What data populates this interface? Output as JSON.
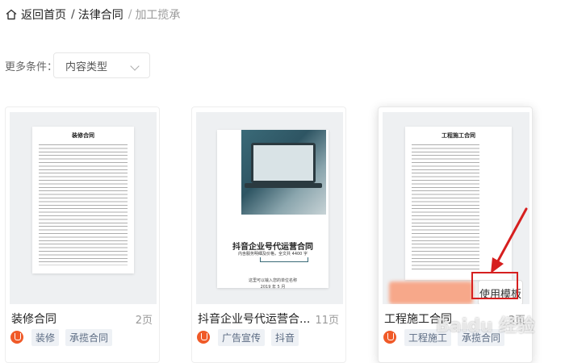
{
  "breadcrumb": {
    "home": "返回首页",
    "separator": "/",
    "category": "法律合同",
    "current": "加工揽承"
  },
  "filter": {
    "label": "更多条件：",
    "select_value": "内容类型"
  },
  "cards": [
    {
      "title": "装修合同",
      "pages": "2页",
      "tags": [
        "装修",
        "承揽合同"
      ],
      "doc_title": "装修合同"
    },
    {
      "title": "抖音企业号代运营合...",
      "pages": "11页",
      "tags": [
        "广告宣传",
        "抖音"
      ],
      "poster_title": "抖音企业号代运营合同",
      "poster_subtitle": "内含服务明细及价格，全文共 4400 字",
      "poster_placeholder": "这里可以输入您的单位名称",
      "poster_date": "2019 年 5 月"
    },
    {
      "title": "工程施工合同",
      "pages": "3页",
      "tags": [
        "工程施工",
        "承揽合同"
      ],
      "doc_title": "工程施工合同",
      "use_button": "使用模板"
    }
  ],
  "colors": {
    "brand": "#f05a28",
    "highlight": "#d61f1f",
    "tag_bg": "#eef1f5"
  }
}
